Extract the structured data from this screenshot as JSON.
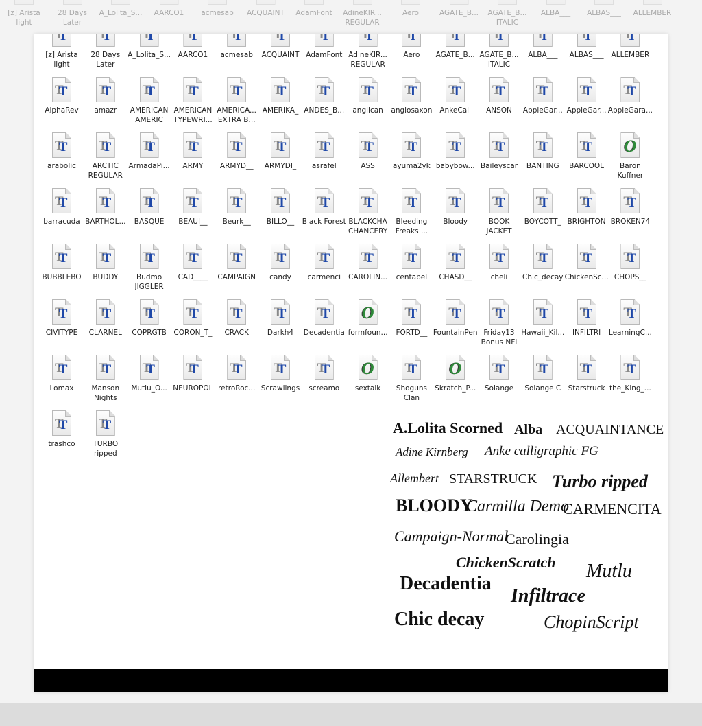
{
  "background_row": [
    "[z] Arista\nlight",
    "28 Days\nLater",
    "A_Lolita_S...",
    "AARCO1",
    "acmesab",
    "ACQUAINT",
    "AdamFont",
    "AdineKIR...\nREGULAR",
    "Aero",
    "AGATE_B...",
    "AGATE_B...\nITALIC",
    "ALBA___",
    "ALBAS___",
    "ALLEMBER"
  ],
  "files": [
    {
      "name": "[z] Arista\nlight",
      "icon": "truetype"
    },
    {
      "name": "28 Days\nLater",
      "icon": "truetype"
    },
    {
      "name": "A_Lolita_S...",
      "icon": "truetype"
    },
    {
      "name": "AARCO1",
      "icon": "truetype"
    },
    {
      "name": "acmesab",
      "icon": "truetype"
    },
    {
      "name": "ACQUAINT",
      "icon": "truetype"
    },
    {
      "name": "AdamFont",
      "icon": "truetype"
    },
    {
      "name": "AdineKIR...\nREGULAR",
      "icon": "truetype"
    },
    {
      "name": "Aero",
      "icon": "truetype"
    },
    {
      "name": "AGATE_B...",
      "icon": "truetype"
    },
    {
      "name": "AGATE_B...\nITALIC",
      "icon": "truetype"
    },
    {
      "name": "ALBA___",
      "icon": "truetype"
    },
    {
      "name": "ALBAS___",
      "icon": "truetype"
    },
    {
      "name": "ALLEMBER",
      "icon": "truetype"
    },
    {
      "name": "AlphaRev",
      "icon": "truetype"
    },
    {
      "name": "amazr",
      "icon": "truetype"
    },
    {
      "name": "AMERICAN\nAMERIC",
      "icon": "truetype"
    },
    {
      "name": "AMERICAN\nTYPEWRI...",
      "icon": "truetype"
    },
    {
      "name": "AMERICA...\nEXTRA B...",
      "icon": "truetype"
    },
    {
      "name": "AMERIKA_",
      "icon": "truetype"
    },
    {
      "name": "ANDES_B...",
      "icon": "truetype"
    },
    {
      "name": "anglican",
      "icon": "truetype"
    },
    {
      "name": "anglosaxon",
      "icon": "truetype"
    },
    {
      "name": "AnkeCall",
      "icon": "truetype"
    },
    {
      "name": "ANSON",
      "icon": "truetype"
    },
    {
      "name": "AppleGar...",
      "icon": "truetype"
    },
    {
      "name": "AppleGar...",
      "icon": "truetype"
    },
    {
      "name": "AppleGara...",
      "icon": "truetype"
    },
    {
      "name": "arabolic",
      "icon": "truetype"
    },
    {
      "name": "ARCTIC\nREGULAR",
      "icon": "truetype"
    },
    {
      "name": "ArmadaPi...",
      "icon": "truetype"
    },
    {
      "name": "ARMY",
      "icon": "truetype"
    },
    {
      "name": "ARMYD__",
      "icon": "truetype"
    },
    {
      "name": "ARMYDI_",
      "icon": "truetype"
    },
    {
      "name": "asrafel",
      "icon": "truetype"
    },
    {
      "name": "ASS",
      "icon": "truetype"
    },
    {
      "name": "ayuma2yk",
      "icon": "truetype"
    },
    {
      "name": "babybow...",
      "icon": "truetype"
    },
    {
      "name": "Baileyscar",
      "icon": "truetype"
    },
    {
      "name": "BANTING",
      "icon": "truetype"
    },
    {
      "name": "BARCOOL",
      "icon": "truetype"
    },
    {
      "name": "Baron\nKuffner",
      "icon": "opentype"
    },
    {
      "name": "barracuda",
      "icon": "truetype"
    },
    {
      "name": "BARTHOL...",
      "icon": "truetype"
    },
    {
      "name": "BASQUE",
      "icon": "truetype"
    },
    {
      "name": "BEAUI__",
      "icon": "truetype"
    },
    {
      "name": "Beurk__",
      "icon": "truetype"
    },
    {
      "name": "BILLO__",
      "icon": "truetype"
    },
    {
      "name": "Black Forest",
      "icon": "truetype"
    },
    {
      "name": "BLACKCHA\nCHANCERY",
      "icon": "truetype"
    },
    {
      "name": "Bleeding\nFreaks ...",
      "icon": "truetype"
    },
    {
      "name": "Bloody",
      "icon": "truetype"
    },
    {
      "name": "BOOK\nJACKET",
      "icon": "truetype"
    },
    {
      "name": "BOYCOTT_",
      "icon": "truetype"
    },
    {
      "name": "BRIGHTON",
      "icon": "truetype"
    },
    {
      "name": "BROKEN74",
      "icon": "truetype"
    },
    {
      "name": "BUBBLEBO",
      "icon": "truetype"
    },
    {
      "name": "BUDDY",
      "icon": "truetype"
    },
    {
      "name": "Budmo\nJIGGLER",
      "icon": "truetype"
    },
    {
      "name": "CAD____",
      "icon": "truetype"
    },
    {
      "name": "CAMPAIGN",
      "icon": "truetype"
    },
    {
      "name": "candy",
      "icon": "truetype"
    },
    {
      "name": "carmenci",
      "icon": "truetype"
    },
    {
      "name": "CAROLIN...",
      "icon": "truetype"
    },
    {
      "name": "centabel",
      "icon": "truetype"
    },
    {
      "name": "CHASD__",
      "icon": "truetype"
    },
    {
      "name": "cheli",
      "icon": "truetype"
    },
    {
      "name": "Chic_decay",
      "icon": "truetype"
    },
    {
      "name": "ChickenSc...",
      "icon": "truetype"
    },
    {
      "name": "CHOPS__",
      "icon": "truetype"
    },
    {
      "name": "CIVITYPE",
      "icon": "truetype"
    },
    {
      "name": "CLARNEL",
      "icon": "truetype"
    },
    {
      "name": "COPRGTB",
      "icon": "truetype"
    },
    {
      "name": "CORON_T_",
      "icon": "truetype"
    },
    {
      "name": "CRACK",
      "icon": "truetype"
    },
    {
      "name": "Darkh4",
      "icon": "truetype"
    },
    {
      "name": "Decadentia",
      "icon": "truetype"
    },
    {
      "name": "formfoun...",
      "icon": "opentype"
    },
    {
      "name": "FORTD__",
      "icon": "truetype"
    },
    {
      "name": "FountainPen",
      "icon": "truetype"
    },
    {
      "name": "Friday13\nBonus NFI",
      "icon": "truetype"
    },
    {
      "name": "Hawaii_Kil...",
      "icon": "truetype"
    },
    {
      "name": "INFILTRI",
      "icon": "truetype"
    },
    {
      "name": "LearningC...",
      "icon": "truetype"
    },
    {
      "name": "Lomax",
      "icon": "truetype"
    },
    {
      "name": "Manson\nNights",
      "icon": "truetype"
    },
    {
      "name": "Mutlu_O...",
      "icon": "truetype"
    },
    {
      "name": "NEUROPOL",
      "icon": "truetype"
    },
    {
      "name": "retroRoc...",
      "icon": "truetype"
    },
    {
      "name": "Scrawlings",
      "icon": "truetype"
    },
    {
      "name": "screamo",
      "icon": "truetype"
    },
    {
      "name": "sextalk",
      "icon": "opentype"
    },
    {
      "name": "Shoguns\nClan",
      "icon": "truetype"
    },
    {
      "name": "Skratch_P...",
      "icon": "opentype"
    },
    {
      "name": "Solange",
      "icon": "truetype"
    },
    {
      "name": "Solange C",
      "icon": "truetype"
    },
    {
      "name": "Starstruck",
      "icon": "truetype"
    },
    {
      "name": "the_King_...",
      "icon": "truetype"
    },
    {
      "name": "trashco",
      "icon": "truetype"
    },
    {
      "name": "TURBO\nripped",
      "icon": "truetype"
    }
  ],
  "icon_glyphs": {
    "truetype": "TT",
    "opentype": "O"
  },
  "colors": {
    "tt_blue": "#1f48a8",
    "tt_gray": "#8a8a8a",
    "otf_green": "#2f8a3a"
  },
  "specimen": [
    "A.Lolita Scorned",
    "Alba",
    "ACQUAINTANCE",
    "Adine Kirnberg",
    "Anke calligraphic FG",
    "Allembert",
    "STARSTRUCK",
    "Turbo ripped",
    "BLOODY",
    "Carmilla Demo",
    "CARMENCITA",
    "Campaign-Normal",
    "Carolingia",
    "ChickenScratch",
    "Mutlu",
    "Decadentia",
    "Infiltrace",
    "Chic decay",
    "ChopinScript"
  ]
}
